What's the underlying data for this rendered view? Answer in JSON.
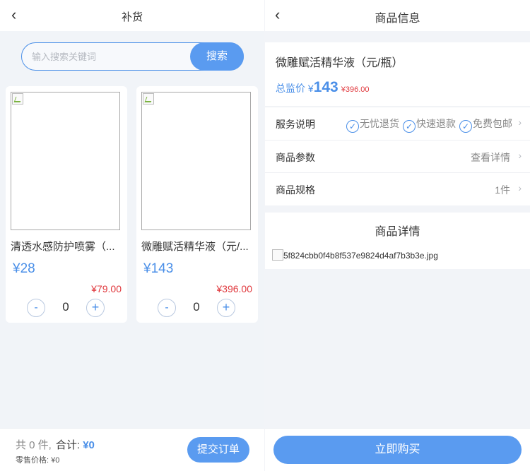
{
  "left": {
    "title": "补货",
    "back_icon": "chevron-left-icon",
    "search": {
      "placeholder": "输入搜索关键词",
      "button_label": "搜索"
    },
    "products": [
      {
        "name": "清透水感防护喷雾（...",
        "price": "¥28",
        "original_price": "¥79.00",
        "quantity": "0"
      },
      {
        "name": "微雕赋活精华液（元/...",
        "price": "¥143",
        "original_price": "¥396.00",
        "quantity": "0"
      }
    ],
    "stepper": {
      "minus": "-",
      "plus": "+"
    },
    "footer": {
      "count_text": "共 0 件,",
      "total_label": "合计:",
      "total_amount": "¥0",
      "retail_text": "零售价格: ¥0",
      "submit_label": "提交订单"
    }
  },
  "right": {
    "title": "商品信息",
    "product_name": "微雕赋活精华液（元/瓶）",
    "price_label": "总监价 ¥",
    "price": "143",
    "original_price": "¥396.00",
    "rows": {
      "service": {
        "label": "服务说明",
        "tags": [
          "无忧退货",
          "快速退款",
          "免费包邮"
        ]
      },
      "params": {
        "label": "商品参数",
        "value": "查看详情"
      },
      "spec": {
        "label": "商品规格",
        "value": "1件"
      }
    },
    "detail": {
      "title": "商品详情",
      "image_alt": "5f824cbb0f4b8f537e9824d4af7b3b3e.jpg"
    },
    "buy_label": "立即购买"
  },
  "colors": {
    "accent": "#5a9bf0",
    "price_blue": "#4a8fe8",
    "price_red": "#e0393e"
  }
}
